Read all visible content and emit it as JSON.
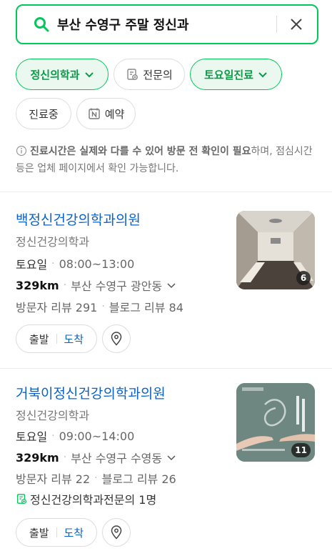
{
  "search": {
    "query": "부산 수영구 주말 정신과"
  },
  "filters": [
    {
      "label": "정신의학과",
      "active": true,
      "icon": "chevron-down-icon"
    },
    {
      "label": "전문의",
      "active": false,
      "icon": "specialist-doc-icon"
    },
    {
      "label": "토요일진료",
      "active": true,
      "icon": "chevron-down-icon"
    },
    {
      "label": "진료중",
      "active": false,
      "icon": ""
    },
    {
      "label": "예약",
      "active": false,
      "icon": "naver-n-icon"
    }
  ],
  "notice": {
    "bold": "진료시간은 실제와 다를 수 있어 방문 전 확인이 필요",
    "rest": "하며, 점심시간 등은 업체 페이지에서 확인 가능합니다."
  },
  "results": [
    {
      "name": "백정신건강의학과의원",
      "category": "정신건강의학과",
      "day": "토요일",
      "hours": "08:00~13:00",
      "distance": "329km",
      "address": "부산 수영구 광안동",
      "visitor_reviews": "방문자 리뷰 291",
      "blog_reviews": "블로그 리뷰 84",
      "photo_count": "6",
      "route_start": "출발",
      "route_arrive": "도착"
    },
    {
      "name": "거북이정신건강의학과의원",
      "category": "정신건강의학과",
      "day": "토요일",
      "hours": "09:00~14:00",
      "distance": "329km",
      "address": "부산 수영구 수영동",
      "visitor_reviews": "방문자 리뷰 22",
      "blog_reviews": "블로그 리뷰 26",
      "specialist": "정신건강의학과전문의 1명",
      "photo_count": "11",
      "route_start": "출발",
      "route_arrive": "도착"
    }
  ],
  "colors": {
    "accent": "#03c75a",
    "link": "#0a62c9"
  }
}
